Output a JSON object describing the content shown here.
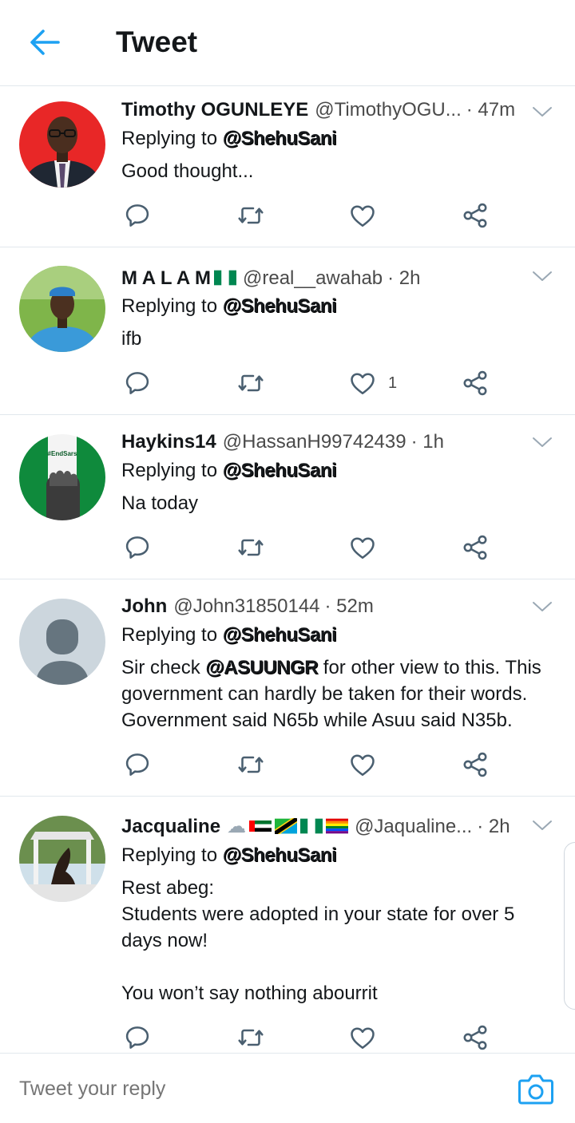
{
  "header": {
    "title": "Tweet"
  },
  "reply_prefix": "Replying to",
  "tweets": [
    {
      "name": "Timothy OGUNLEYE",
      "handle": "@TimothyOGU...",
      "time": "· 47m",
      "reply_to": "@ShehuSani",
      "text": "Good thought...",
      "like_count": ""
    },
    {
      "name": "M A L A M",
      "handle": "@real__awahab",
      "time": "· 2h",
      "reply_to": "@ShehuSani",
      "text": "ifb",
      "like_count": "1"
    },
    {
      "name": "Haykins14",
      "handle": "@HassanH99742439",
      "time": "· 1h",
      "reply_to": "@ShehuSani",
      "text": "Na today",
      "like_count": ""
    },
    {
      "name": "John",
      "handle": "@John31850144",
      "time": "· 52m",
      "reply_to": "@ShehuSani",
      "text_prefix": "Sir check ",
      "text_mention": "@ASUUNGR",
      "text": " for other view to this. This\ngovernment can hardly be taken for their words.\nGovernment said N65b while Asuu said N35b.",
      "like_count": ""
    },
    {
      "name": "Jacqualine",
      "handle": "@Jaqualine...",
      "time": "· 2h",
      "reply_to": "@ShehuSani",
      "text": "Rest abeg:\nStudents were adopted in your state for over 5\ndays now!\n\nYou won’t say nothing abourrit",
      "like_count": ""
    }
  ],
  "avatar_labels": {
    "endsars": "#EndSars"
  },
  "composer": {
    "placeholder": "Tweet your reply"
  },
  "colors": {
    "accent": "#1da1f2",
    "icon": "#4a5f70",
    "divider": "#e1e8ed"
  },
  "icons": [
    "back-arrow-icon",
    "chevron-down-icon",
    "reply-icon",
    "retweet-icon",
    "like-icon",
    "share-icon",
    "camera-icon"
  ]
}
